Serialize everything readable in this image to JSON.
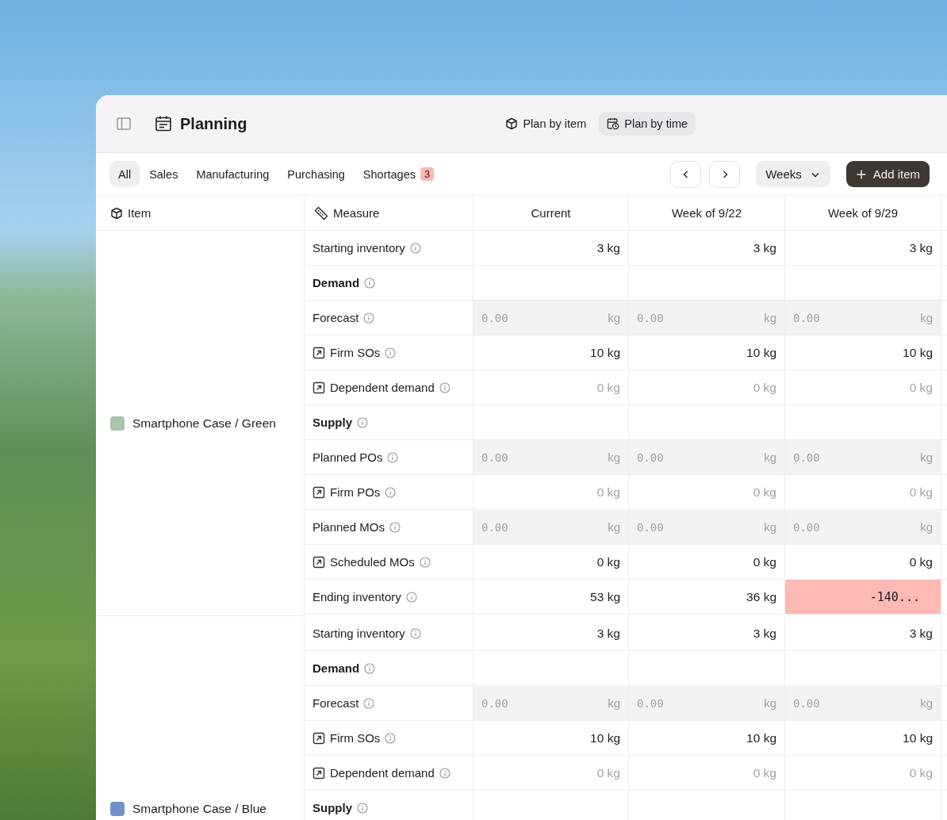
{
  "window": {
    "title": "Planning"
  },
  "view_switch": [
    {
      "label": "Plan by item",
      "kind": "item",
      "selected": false
    },
    {
      "label": "Plan by time",
      "kind": "time",
      "selected": true
    }
  ],
  "tabs": [
    {
      "label": "All",
      "selected": true
    },
    {
      "label": "Sales",
      "selected": false
    },
    {
      "label": "Manufacturing",
      "selected": false
    },
    {
      "label": "Purchasing",
      "selected": false
    },
    {
      "label": "Shortages",
      "selected": false,
      "badge": "3"
    }
  ],
  "period_select": {
    "value": "Weeks"
  },
  "add_button": {
    "label": "Add item"
  },
  "table": {
    "columns": [
      {
        "label": "Item",
        "kind": "item"
      },
      {
        "label": "Measure",
        "kind": "measure"
      },
      {
        "label": "Current",
        "kind": "period"
      },
      {
        "label": "Week of 9/22",
        "kind": "period"
      },
      {
        "label": "Week of 9/29",
        "kind": "period"
      }
    ],
    "groups": [
      {
        "item": "Smartphone Case / Green",
        "color": "#a9c4a8",
        "rows": [
          {
            "measure": "Starting inventory",
            "kind": "measure",
            "linked": false,
            "cells": [
              {
                "kind": "value",
                "text": "3 kg"
              },
              {
                "kind": "value",
                "text": "3 kg"
              },
              {
                "kind": "value",
                "text": "3 kg"
              }
            ]
          },
          {
            "measure": "Demand",
            "kind": "section",
            "linked": false,
            "cells": [
              {
                "kind": "empty"
              },
              {
                "kind": "empty"
              },
              {
                "kind": "empty"
              }
            ]
          },
          {
            "measure": "Forecast",
            "kind": "measure",
            "linked": false,
            "cells": [
              {
                "kind": "input",
                "placeholder": "0.00",
                "unit": "kg"
              },
              {
                "kind": "input",
                "placeholder": "0.00",
                "unit": "kg"
              },
              {
                "kind": "input",
                "placeholder": "0.00",
                "unit": "kg"
              }
            ]
          },
          {
            "measure": "Firm SOs",
            "kind": "measure",
            "linked": true,
            "cells": [
              {
                "kind": "value",
                "text": "10 kg"
              },
              {
                "kind": "value",
                "text": "10 kg"
              },
              {
                "kind": "value",
                "text": "10 kg"
              }
            ]
          },
          {
            "measure": "Dependent demand",
            "kind": "measure",
            "linked": true,
            "cells": [
              {
                "kind": "muted",
                "text": "0 kg"
              },
              {
                "kind": "muted",
                "text": "0 kg"
              },
              {
                "kind": "muted",
                "text": "0 kg"
              }
            ]
          },
          {
            "measure": "Supply",
            "kind": "section",
            "linked": false,
            "cells": [
              {
                "kind": "empty"
              },
              {
                "kind": "empty"
              },
              {
                "kind": "empty"
              }
            ]
          },
          {
            "measure": "Planned POs",
            "kind": "measure",
            "linked": false,
            "cells": [
              {
                "kind": "input",
                "placeholder": "0.00",
                "unit": "kg"
              },
              {
                "kind": "input",
                "placeholder": "0.00",
                "unit": "kg"
              },
              {
                "kind": "input",
                "placeholder": "0.00",
                "unit": "kg"
              }
            ]
          },
          {
            "measure": "Firm POs",
            "kind": "measure",
            "linked": true,
            "cells": [
              {
                "kind": "muted",
                "text": "0 kg"
              },
              {
                "kind": "muted",
                "text": "0 kg"
              },
              {
                "kind": "muted",
                "text": "0 kg"
              }
            ]
          },
          {
            "measure": "Planned MOs",
            "kind": "measure",
            "linked": false,
            "cells": [
              {
                "kind": "input",
                "placeholder": "0.00",
                "unit": "kg"
              },
              {
                "kind": "input",
                "placeholder": "0.00",
                "unit": "kg"
              },
              {
                "kind": "input",
                "placeholder": "0.00",
                "unit": "kg"
              }
            ]
          },
          {
            "measure": "Scheduled MOs",
            "kind": "measure",
            "linked": true,
            "cells": [
              {
                "kind": "value",
                "text": "0 kg"
              },
              {
                "kind": "value",
                "text": "0 kg"
              },
              {
                "kind": "value",
                "text": "0 kg"
              }
            ]
          },
          {
            "measure": "Ending inventory",
            "kind": "measure",
            "linked": false,
            "cells": [
              {
                "kind": "value",
                "text": "53 kg"
              },
              {
                "kind": "value",
                "text": "36 kg"
              },
              {
                "kind": "shortage",
                "text": "-140..."
              }
            ]
          }
        ]
      },
      {
        "item": "Smartphone Case / Blue",
        "color": "#6f93c7",
        "rows": [
          {
            "measure": "Starting inventory",
            "kind": "measure",
            "linked": false,
            "cells": [
              {
                "kind": "value",
                "text": "3 kg"
              },
              {
                "kind": "value",
                "text": "3 kg"
              },
              {
                "kind": "value",
                "text": "3 kg"
              }
            ]
          },
          {
            "measure": "Demand",
            "kind": "section",
            "linked": false,
            "cells": [
              {
                "kind": "empty"
              },
              {
                "kind": "empty"
              },
              {
                "kind": "empty"
              }
            ]
          },
          {
            "measure": "Forecast",
            "kind": "measure",
            "linked": false,
            "cells": [
              {
                "kind": "input",
                "placeholder": "0.00",
                "unit": "kg"
              },
              {
                "kind": "input",
                "placeholder": "0.00",
                "unit": "kg"
              },
              {
                "kind": "input",
                "placeholder": "0.00",
                "unit": "kg"
              }
            ]
          },
          {
            "measure": "Firm SOs",
            "kind": "measure",
            "linked": true,
            "cells": [
              {
                "kind": "value",
                "text": "10 kg"
              },
              {
                "kind": "value",
                "text": "10 kg"
              },
              {
                "kind": "value",
                "text": "10 kg"
              }
            ]
          },
          {
            "measure": "Dependent demand",
            "kind": "measure",
            "linked": true,
            "cells": [
              {
                "kind": "muted",
                "text": "0 kg"
              },
              {
                "kind": "muted",
                "text": "0 kg"
              },
              {
                "kind": "muted",
                "text": "0 kg"
              }
            ]
          },
          {
            "measure": "Supply",
            "kind": "section",
            "linked": false,
            "cells": [
              {
                "kind": "empty"
              },
              {
                "kind": "empty"
              },
              {
                "kind": "empty"
              }
            ]
          }
        ]
      }
    ]
  }
}
